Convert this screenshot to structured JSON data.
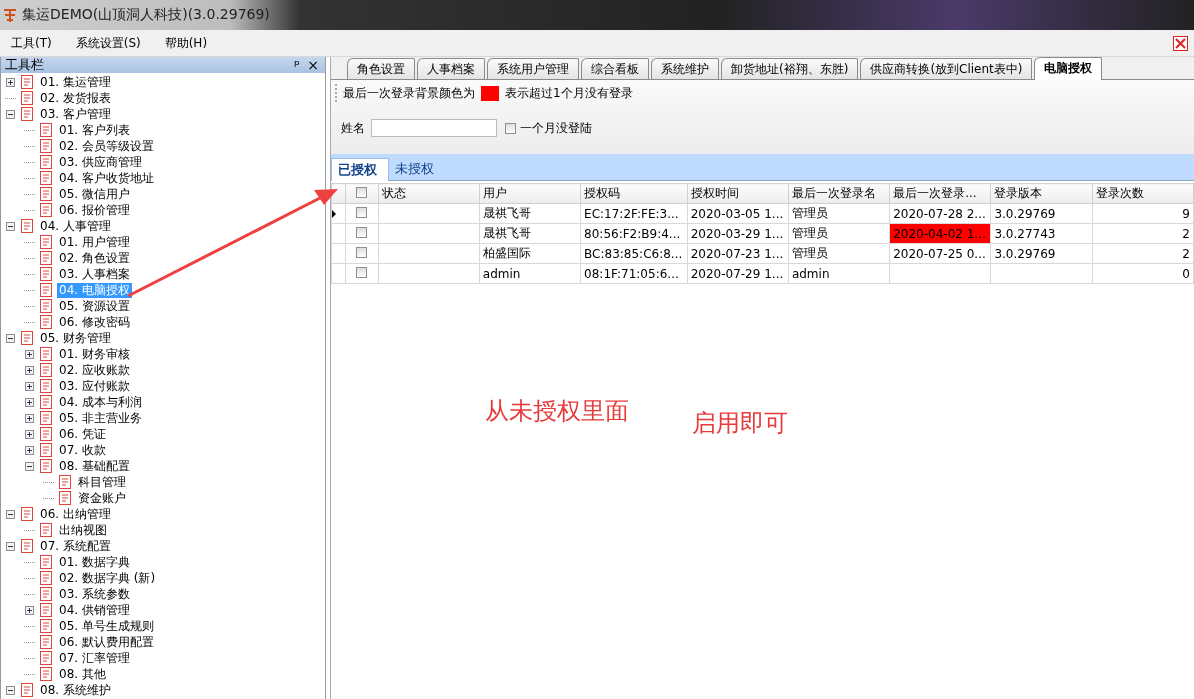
{
  "window": {
    "title": "集运DEMO(山顶洞人科技)(3.0.29769)"
  },
  "menu": [
    "工具(T)",
    "系统设置(S)",
    "帮助(H)"
  ],
  "toolbar_panel": {
    "title": "工具栏",
    "pin": "ᵖ",
    "close": "×"
  },
  "tree": [
    {
      "label": "01. 集运管理",
      "expanded": false,
      "selected": false
    },
    {
      "label": "02. 发货报表",
      "selected": false
    },
    {
      "label": "03. 客户管理",
      "expanded": true,
      "selected": false,
      "children": [
        {
          "label": "01. 客户列表",
          "selected": false
        },
        {
          "label": "02. 会员等级设置",
          "selected": false
        },
        {
          "label": "03. 供应商管理",
          "selected": false
        },
        {
          "label": "04. 客户收货地址",
          "selected": false
        },
        {
          "label": "05. 微信用户",
          "selected": false
        },
        {
          "label": "06. 报价管理",
          "selected": false
        }
      ]
    },
    {
      "label": "04. 人事管理",
      "expanded": true,
      "selected": false,
      "children": [
        {
          "label": "01. 用户管理",
          "selected": false
        },
        {
          "label": "02. 角色设置",
          "selected": false
        },
        {
          "label": "03. 人事档案",
          "selected": false
        },
        {
          "label": "04. 电脑授权",
          "selected": true
        },
        {
          "label": "05. 资源设置",
          "selected": false
        },
        {
          "label": "06. 修改密码",
          "selected": false
        }
      ]
    },
    {
      "label": "05. 财务管理",
      "expanded": true,
      "selected": false,
      "children": [
        {
          "label": "01. 财务审核",
          "expanded": false,
          "selected": false
        },
        {
          "label": "02. 应收账款",
          "expanded": false,
          "selected": false
        },
        {
          "label": "03. 应付账款",
          "expanded": false,
          "selected": false
        },
        {
          "label": "04. 成本与利润",
          "expanded": false,
          "selected": false
        },
        {
          "label": "05. 非主营业务",
          "expanded": false,
          "selected": false
        },
        {
          "label": "06. 凭证",
          "expanded": false,
          "selected": false
        },
        {
          "label": "07. 收款",
          "expanded": false,
          "selected": false
        },
        {
          "label": "08. 基础配置",
          "expanded": true,
          "selected": false,
          "children": [
            {
              "label": "科目管理",
              "selected": false
            },
            {
              "label": "资金账户",
              "selected": false
            }
          ]
        }
      ]
    },
    {
      "label": "06. 出纳管理",
      "expanded": true,
      "selected": false,
      "children": [
        {
          "label": "出纳视图",
          "selected": false
        }
      ]
    },
    {
      "label": "07. 系统配置",
      "expanded": true,
      "selected": false,
      "children": [
        {
          "label": "01. 数据字典",
          "selected": false
        },
        {
          "label": "02. 数据字典 (新)",
          "selected": false
        },
        {
          "label": "03. 系统参数",
          "selected": false
        },
        {
          "label": "04. 供销管理",
          "expanded": false,
          "selected": false
        },
        {
          "label": "05. 单号生成规则",
          "selected": false
        },
        {
          "label": "06. 默认费用配置",
          "selected": false
        },
        {
          "label": "07. 汇率管理",
          "selected": false
        },
        {
          "label": "08. 其他",
          "selected": false
        }
      ]
    },
    {
      "label": "08. 系统维护",
      "expanded": true,
      "selected": false
    }
  ],
  "tabs": [
    {
      "label": "角色设置",
      "selected": false
    },
    {
      "label": "人事档案",
      "selected": false
    },
    {
      "label": "系统用户管理",
      "selected": false
    },
    {
      "label": "综合看板",
      "selected": false
    },
    {
      "label": "系统维护",
      "selected": false
    },
    {
      "label": "卸货地址(裕翔、东胜)",
      "selected": false
    },
    {
      "label": "供应商转换(放到Client表中)",
      "selected": false
    },
    {
      "label": "电脑授权",
      "selected": true
    }
  ],
  "legend": {
    "before": "最后一次登录背景颜色为",
    "color": "#ff0000",
    "after": "表示超过1个月没有登录"
  },
  "filter": {
    "name_label": "姓名",
    "checkbox_label": "一个月没登陆",
    "checked": false
  },
  "subtabs": [
    {
      "label": "已授权",
      "selected": true
    },
    {
      "label": "未授权",
      "selected": false
    }
  ],
  "table": {
    "select_all_checked": false,
    "columns": [
      "状态",
      "用户",
      "授权码",
      "授权时间",
      "最后一次登录名",
      "最后一次登录...",
      "登录版本",
      "登录次数"
    ],
    "rows": [
      {
        "current": true,
        "checked": false,
        "stale": false,
        "cells": [
          "",
          "晟祺飞哥",
          "EC:17:2F:FE:3...",
          "2020-03-05 1...",
          "管理员",
          "2020-07-28 2...",
          "3.0.29769",
          "9"
        ]
      },
      {
        "current": false,
        "checked": false,
        "stale": true,
        "cells": [
          "",
          "晟祺飞哥",
          "80:56:F2:B9:4...",
          "2020-03-29 1...",
          "管理员",
          "2020-04-02 1...",
          "3.0.27743",
          "2"
        ]
      },
      {
        "current": false,
        "checked": false,
        "stale": false,
        "cells": [
          "",
          "柏盛国际",
          "BC:83:85:C6:8...",
          "2020-07-23 1...",
          "管理员",
          "2020-07-25 0...",
          "3.0.29769",
          "2"
        ]
      },
      {
        "current": false,
        "checked": false,
        "stale": false,
        "cells": [
          "",
          "admin",
          "08:1F:71:05:6...",
          "2020-07-29 1...",
          "admin",
          "",
          "",
          "0"
        ]
      }
    ]
  },
  "annotations": [
    "从未授权里面",
    "启用即可"
  ]
}
